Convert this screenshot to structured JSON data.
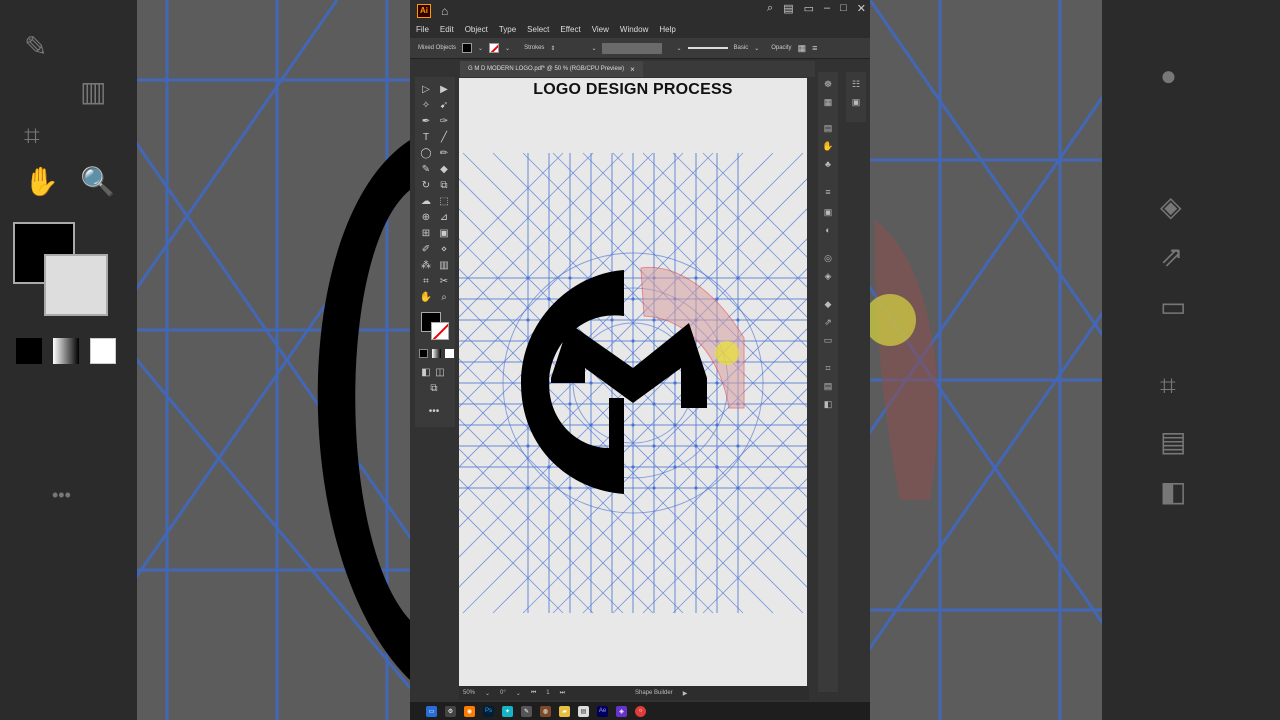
{
  "window": {
    "app_icon": "Ai",
    "menu": [
      "File",
      "Edit",
      "Object",
      "Type",
      "Select",
      "Effect",
      "View",
      "Window",
      "Help"
    ]
  },
  "control_bar": {
    "selection_label": "Mixed Objects",
    "strokes_label": "Strokes",
    "brush_label": "Basic",
    "opacity_label": "Opacity"
  },
  "document": {
    "tab_title": "G M D MODERN LOGO.pdf* @ 50 % (RGB/CPU Preview)",
    "tab_close": "×"
  },
  "artwork": {
    "heading": "LOGO DESIGN PROCESS",
    "logo_letters": "GMD"
  },
  "status": {
    "zoom": "50%",
    "rotation": "0°",
    "artboard": "1",
    "active_tool": "Shape Builder"
  },
  "colors": {
    "grid_line": "#4a73d6",
    "canvas_bg": "#e8e8e8",
    "ui_bg": "#323232",
    "highlight_red": "#e03c3c",
    "highlight_yellow": "#e8e030"
  },
  "icons": [
    "home-icon",
    "search-icon",
    "arrange-icon",
    "minimize-icon",
    "maximize-icon",
    "close-icon"
  ]
}
